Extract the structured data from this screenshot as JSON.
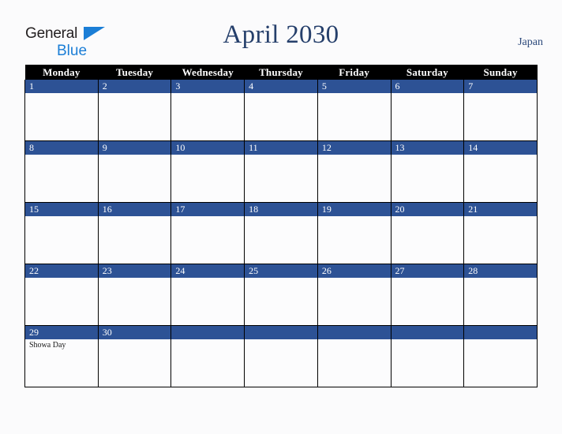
{
  "branding": {
    "logo_word1": "General",
    "logo_word2": "Blue",
    "logo_triangle": "blue-triangle-icon",
    "logo_color_dark": "#231f20",
    "logo_color_blue": "#1b7ed6"
  },
  "header": {
    "title": "April 2030",
    "country": "Japan",
    "title_color": "#253f6b"
  },
  "calendar": {
    "accent_color": "#2d5295",
    "header_bg": "#000000",
    "weekdays": [
      "Monday",
      "Tuesday",
      "Wednesday",
      "Thursday",
      "Friday",
      "Saturday",
      "Sunday"
    ],
    "weeks": [
      [
        {
          "day": "1",
          "events": []
        },
        {
          "day": "2",
          "events": []
        },
        {
          "day": "3",
          "events": []
        },
        {
          "day": "4",
          "events": []
        },
        {
          "day": "5",
          "events": []
        },
        {
          "day": "6",
          "events": []
        },
        {
          "day": "7",
          "events": []
        }
      ],
      [
        {
          "day": "8",
          "events": []
        },
        {
          "day": "9",
          "events": []
        },
        {
          "day": "10",
          "events": []
        },
        {
          "day": "11",
          "events": []
        },
        {
          "day": "12",
          "events": []
        },
        {
          "day": "13",
          "events": []
        },
        {
          "day": "14",
          "events": []
        }
      ],
      [
        {
          "day": "15",
          "events": []
        },
        {
          "day": "16",
          "events": []
        },
        {
          "day": "17",
          "events": []
        },
        {
          "day": "18",
          "events": []
        },
        {
          "day": "19",
          "events": []
        },
        {
          "day": "20",
          "events": []
        },
        {
          "day": "21",
          "events": []
        }
      ],
      [
        {
          "day": "22",
          "events": []
        },
        {
          "day": "23",
          "events": []
        },
        {
          "day": "24",
          "events": []
        },
        {
          "day": "25",
          "events": []
        },
        {
          "day": "26",
          "events": []
        },
        {
          "day": "27",
          "events": []
        },
        {
          "day": "28",
          "events": []
        }
      ],
      [
        {
          "day": "29",
          "events": [
            "Showa Day"
          ]
        },
        {
          "day": "30",
          "events": []
        },
        {
          "day": "",
          "events": []
        },
        {
          "day": "",
          "events": []
        },
        {
          "day": "",
          "events": []
        },
        {
          "day": "",
          "events": []
        },
        {
          "day": "",
          "events": []
        }
      ]
    ]
  }
}
